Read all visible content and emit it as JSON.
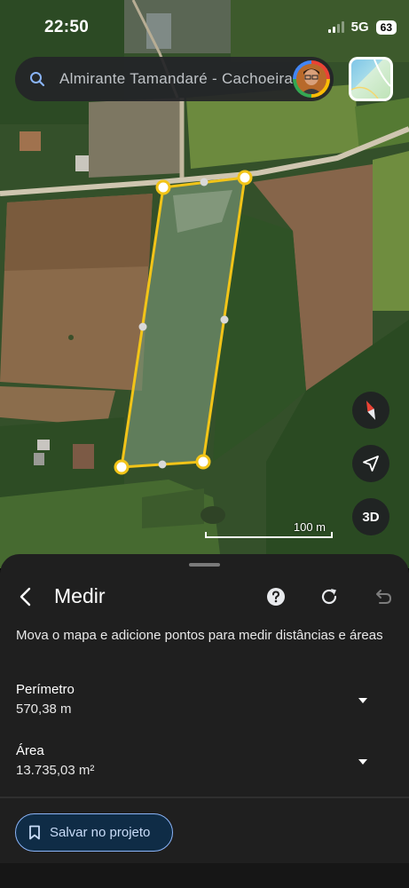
{
  "status_bar": {
    "time": "22:50",
    "network": "5G",
    "battery": "63"
  },
  "search": {
    "text": "Almirante Tamandaré - Cachoeira"
  },
  "map": {
    "controls": {
      "view_3d_label": "3D"
    },
    "scale_label": "100 m"
  },
  "panel": {
    "title": "Medir",
    "instructions": "Mova o mapa e adicione pontos para medir distâncias e áreas",
    "perimeter": {
      "label": "Perímetro",
      "value": "570,38 m"
    },
    "area": {
      "label": "Área",
      "value": "13.735,03 m²"
    },
    "save_button": "Salvar no projeto"
  },
  "colors": {
    "measure_outline": "#f2c418",
    "accent_blue": "#8ab4f8",
    "sheet_bg": "#1f1f1f"
  }
}
